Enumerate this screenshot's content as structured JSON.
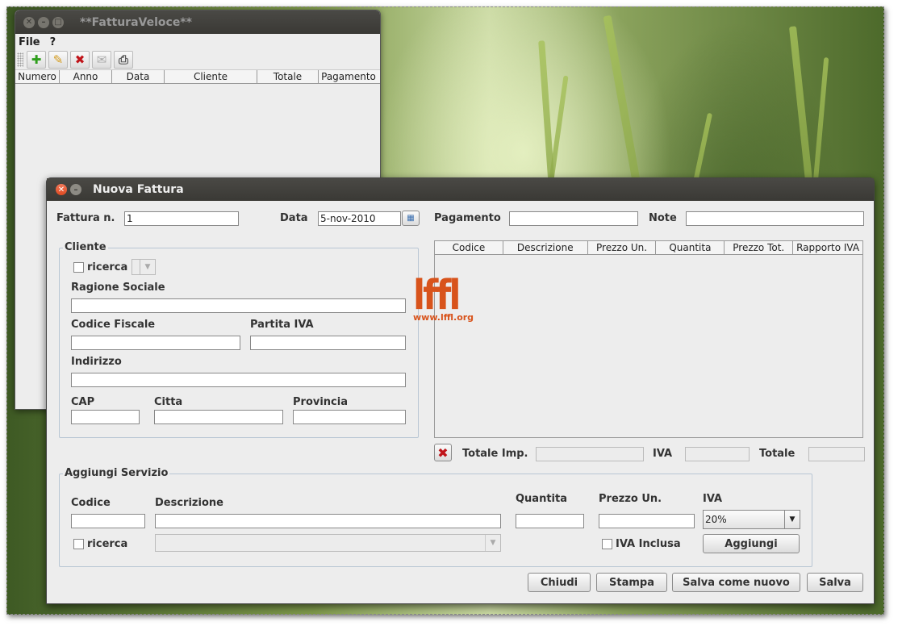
{
  "main_window": {
    "title": "**FatturaVeloce**",
    "menu": [
      "File",
      "?"
    ],
    "toolbar": {
      "icons": [
        "add-icon",
        "edit-icon",
        "delete-icon",
        "email-icon",
        "print-icon"
      ],
      "glyphs": [
        "✚",
        "✎",
        "✖",
        "✉",
        "⎙"
      ]
    },
    "table_columns": [
      "Numero",
      "Anno",
      "Data",
      "Cliente",
      "Totale",
      "Pagamento"
    ]
  },
  "dialog": {
    "title": "Nuova Fattura",
    "fattura_label": "Fattura n.",
    "fattura_value": "1",
    "data_label": "Data",
    "data_value": "5-nov-2010",
    "pagamento_label": "Pagamento",
    "pagamento_value": "",
    "note_label": "Note",
    "note_value": "",
    "cliente": {
      "legend": "Cliente",
      "ricerca": "ricerca",
      "ragione_sociale": "Ragione Sociale",
      "codice_fiscale": "Codice Fiscale",
      "partita_iva": "Partita IVA",
      "indirizzo": "Indirizzo",
      "cap": "CAP",
      "citta": "Citta",
      "provincia": "Provincia"
    },
    "items_table_columns": [
      "Codice",
      "Descrizione",
      "Prezzo Un.",
      "Quantita",
      "Prezzo Tot.",
      "Rapporto IVA"
    ],
    "totals": {
      "imp_label": "Totale Imp.",
      "iva_label": "IVA",
      "totale_label": "Totale"
    },
    "servizio": {
      "legend": "Aggiungi Servizio",
      "codice": "Codice",
      "descrizione": "Descrizione",
      "quantita": "Quantita",
      "prezzo_un": "Prezzo Un.",
      "iva": "IVA",
      "iva_value": "20%",
      "ricerca": "ricerca",
      "iva_inclusa": "IVA Inclusa",
      "aggiungi": "Aggiungi"
    },
    "buttons": {
      "chiudi": "Chiudi",
      "stampa": "Stampa",
      "salva_nuovo": "Salva come nuovo",
      "salva": "Salva"
    }
  },
  "watermark": {
    "logo": "lffl",
    "url": "www.lffl.org"
  },
  "colors": {
    "accent": "#d8531b",
    "titlebar": "#3c3b37",
    "delete": "#c0141a"
  }
}
